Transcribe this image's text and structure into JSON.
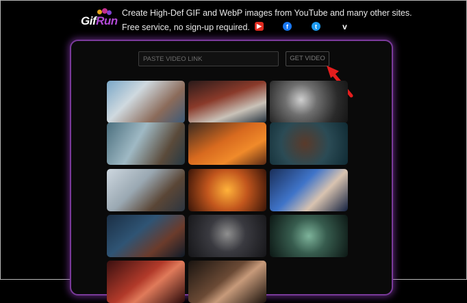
{
  "header": {
    "logo": "GifRun",
    "tagline": "Create High-Def GIF and WebP images from YouTube and many other sites.",
    "subline": "Free service, no sign-up required.",
    "social": [
      {
        "name": "youtube-icon",
        "glyph": "▶",
        "color": "#e02b20"
      },
      {
        "name": "facebook-icon",
        "glyph": "f",
        "color": "#1877f2"
      },
      {
        "name": "twitter-icon",
        "glyph": "t",
        "color": "#1d9bf0"
      },
      {
        "name": "vimeo-icon",
        "glyph": "v",
        "color": "#ffffff"
      }
    ]
  },
  "search": {
    "placeholder": "PASTE VIDEO LINK",
    "button_label": "GET VIDEO"
  },
  "thumbnails": [
    {
      "name": "thumbnail-boat-party"
    },
    {
      "name": "thumbnail-motorcycle-street"
    },
    {
      "name": "thumbnail-smoke-exhale"
    },
    {
      "name": "thumbnail-man-falling"
    },
    {
      "name": "thumbnail-orange-jumpsuits-crowd"
    },
    {
      "name": "thumbnail-woman-close-up"
    },
    {
      "name": "thumbnail-surprised-man"
    },
    {
      "name": "thumbnail-orange-dancers"
    },
    {
      "name": "thumbnail-blue-club-dancer"
    },
    {
      "name": "thumbnail-car-wash-dancer"
    },
    {
      "name": "thumbnail-smoke-dark-figure"
    },
    {
      "name": "thumbnail-neon-face"
    },
    {
      "name": "thumbnail-red-scene"
    },
    {
      "name": "thumbnail-boxing-match"
    }
  ]
}
